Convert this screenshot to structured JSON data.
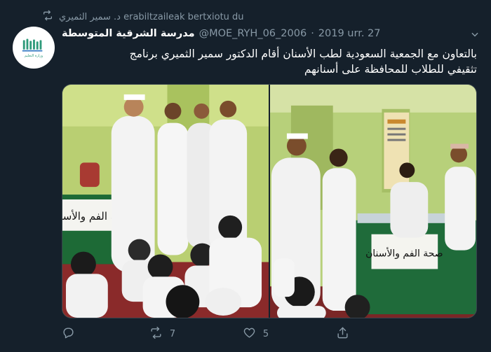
{
  "social_context": {
    "icon": "retweet-icon",
    "text": "د. سمير الثميري erabiltzaileak bertxiotu du"
  },
  "tweet": {
    "avatar": {
      "logo_text": "وزارة التعليم"
    },
    "display_name": "مدرسة الشرقية المتوسطة",
    "handle": "@MOE_RYH_06_2006",
    "separator": "·",
    "date": "2019 urr. 27",
    "text_line1": "بالتعاون مع الجمعية السعودية لطب الأسنان أقام الدكتور سمير الثميري برنامج",
    "text_line2": "تثقيفي للطلاب للمحافظة على أسنانهم",
    "photos": [
      {
        "banner_text": "صحة الفم والأسنان"
      },
      {
        "banner_text": "صحة الفم والأسنان"
      }
    ]
  },
  "actions": {
    "reply": {
      "icon": "reply-icon",
      "count": ""
    },
    "retweet": {
      "icon": "retweet-icon",
      "count": "7"
    },
    "like": {
      "icon": "heart-icon",
      "count": "5"
    },
    "share": {
      "icon": "share-icon",
      "count": ""
    }
  },
  "colors": {
    "background": "#15202b",
    "muted": "#8899a6",
    "border": "#38444d",
    "text": "#ffffff"
  }
}
